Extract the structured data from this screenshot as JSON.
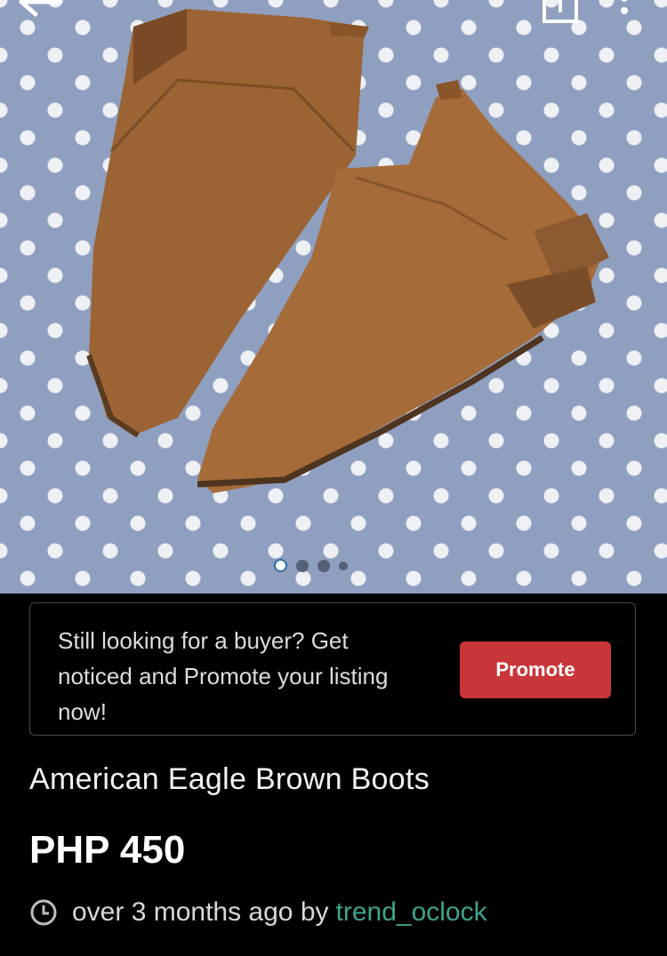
{
  "header": {
    "back_icon": "arrow-left-icon",
    "share_icon": "share-icon",
    "more_icon": "more-vertical-icon"
  },
  "gallery": {
    "image": "brown suede ankle boots on polka-dot fabric",
    "image_count": 4,
    "active_index": 0
  },
  "promo": {
    "message": "Still looking for a buyer? Get noticed and Promote your listing now!",
    "button_label": "Promote",
    "button_color": "#c8363a"
  },
  "listing": {
    "title": "American Eagle Brown Boots",
    "price": "PHP 450",
    "posted": "over 3 months ago by",
    "seller": "trend_oclock",
    "seller_color": "#3fa38c"
  }
}
